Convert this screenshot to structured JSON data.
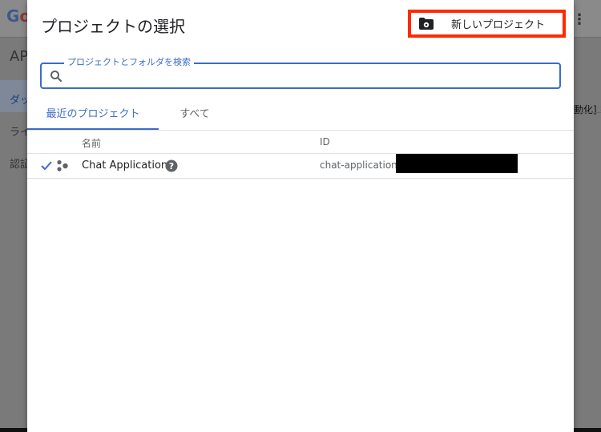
{
  "background": {
    "logo_first": "G",
    "logo_second": "o",
    "title_fragment": "AP",
    "nav_items": [
      "ダッ",
      "ライ",
      "認証"
    ],
    "right_fragment": "動化] を"
  },
  "dialog": {
    "title": "プロジェクトの選択",
    "new_project_label": "新しいプロジェクト",
    "search": {
      "legend": "プロジェクトとフォルダを検索",
      "value": ""
    },
    "tabs": [
      {
        "label": "最近のプロジェクト",
        "active": true
      },
      {
        "label": "すべて",
        "active": false
      }
    ],
    "columns": {
      "name": "名前",
      "id": "ID"
    },
    "projects": [
      {
        "name": "Chat Application",
        "id": "chat-application-",
        "selected": true
      }
    ]
  },
  "colors": {
    "accent": "#3c6cc8",
    "highlight_border": "#ff2a00"
  }
}
